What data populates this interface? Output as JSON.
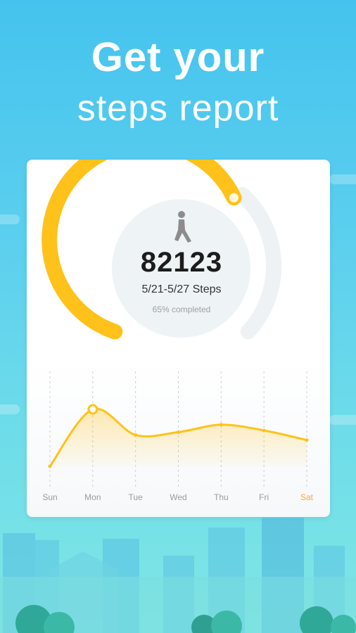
{
  "hero": {
    "title_line1": "Get your",
    "title_line2": "steps report"
  },
  "summary": {
    "steps_total": "82123",
    "range_label": "5/21-5/27 Steps",
    "progress_label": "65% completed",
    "progress_fraction": 0.65
  },
  "icons": {
    "walker": "walking-person-icon"
  },
  "colors": {
    "accent": "#ffc21a",
    "ring_track": "#eef2f4",
    "weekday_label": "#9b9b9b",
    "today_label": "#ffa726",
    "background_top": "#45c3ee",
    "background_bottom": "#7fe6e4"
  },
  "chart_data": {
    "type": "area",
    "categories": [
      "Sun",
      "Mon",
      "Tue",
      "Wed",
      "Thu",
      "Fri",
      "Sat"
    ],
    "values": [
      0,
      1,
      0.55,
      0.6,
      0.73,
      0.63,
      0.46
    ],
    "highlight_category": "Sat",
    "marker_category": "Mon",
    "grid": "vertical dashed",
    "title": "",
    "xlabel": "",
    "ylabel": ""
  }
}
